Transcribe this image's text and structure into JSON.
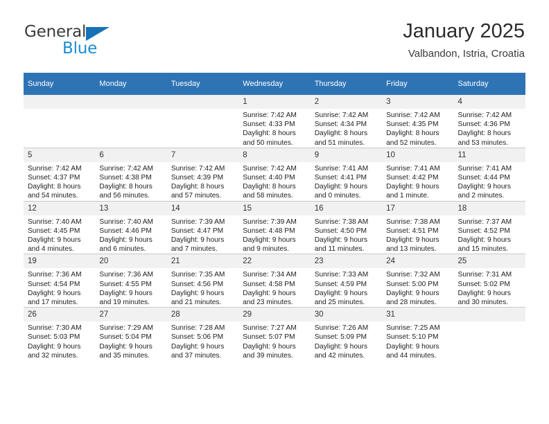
{
  "brand": {
    "word_one": "General",
    "word_two": "Blue",
    "triangle_icon": "brand-triangle-icon",
    "accent_color": "#1672b8",
    "blue_text_color": "#1b8cd4"
  },
  "header": {
    "title": "January 2025",
    "subtitle": "Valbandon, Istria, Croatia"
  },
  "theme": {
    "header_row_bg": "#2e74b5",
    "daynum_strip_bg": "#f1f1f1",
    "grid_line": "#c8c8c8"
  },
  "weekday_headers": [
    "Sunday",
    "Monday",
    "Tuesday",
    "Wednesday",
    "Thursday",
    "Friday",
    "Saturday"
  ],
  "weeks": [
    [
      {
        "day": "",
        "blank": true,
        "lines": []
      },
      {
        "day": "",
        "blank": true,
        "lines": []
      },
      {
        "day": "",
        "blank": true,
        "lines": []
      },
      {
        "day": "1",
        "blank": false,
        "lines": [
          "Sunrise: 7:42 AM",
          "Sunset: 4:33 PM",
          "Daylight: 8 hours",
          "and 50 minutes."
        ]
      },
      {
        "day": "2",
        "blank": false,
        "lines": [
          "Sunrise: 7:42 AM",
          "Sunset: 4:34 PM",
          "Daylight: 8 hours",
          "and 51 minutes."
        ]
      },
      {
        "day": "3",
        "blank": false,
        "lines": [
          "Sunrise: 7:42 AM",
          "Sunset: 4:35 PM",
          "Daylight: 8 hours",
          "and 52 minutes."
        ]
      },
      {
        "day": "4",
        "blank": false,
        "lines": [
          "Sunrise: 7:42 AM",
          "Sunset: 4:36 PM",
          "Daylight: 8 hours",
          "and 53 minutes."
        ]
      }
    ],
    [
      {
        "day": "5",
        "blank": false,
        "lines": [
          "Sunrise: 7:42 AM",
          "Sunset: 4:37 PM",
          "Daylight: 8 hours",
          "and 54 minutes."
        ]
      },
      {
        "day": "6",
        "blank": false,
        "lines": [
          "Sunrise: 7:42 AM",
          "Sunset: 4:38 PM",
          "Daylight: 8 hours",
          "and 56 minutes."
        ]
      },
      {
        "day": "7",
        "blank": false,
        "lines": [
          "Sunrise: 7:42 AM",
          "Sunset: 4:39 PM",
          "Daylight: 8 hours",
          "and 57 minutes."
        ]
      },
      {
        "day": "8",
        "blank": false,
        "lines": [
          "Sunrise: 7:42 AM",
          "Sunset: 4:40 PM",
          "Daylight: 8 hours",
          "and 58 minutes."
        ]
      },
      {
        "day": "9",
        "blank": false,
        "lines": [
          "Sunrise: 7:41 AM",
          "Sunset: 4:41 PM",
          "Daylight: 9 hours",
          "and 0 minutes."
        ]
      },
      {
        "day": "10",
        "blank": false,
        "lines": [
          "Sunrise: 7:41 AM",
          "Sunset: 4:42 PM",
          "Daylight: 9 hours",
          "and 1 minute."
        ]
      },
      {
        "day": "11",
        "blank": false,
        "lines": [
          "Sunrise: 7:41 AM",
          "Sunset: 4:44 PM",
          "Daylight: 9 hours",
          "and 2 minutes."
        ]
      }
    ],
    [
      {
        "day": "12",
        "blank": false,
        "lines": [
          "Sunrise: 7:40 AM",
          "Sunset: 4:45 PM",
          "Daylight: 9 hours",
          "and 4 minutes."
        ]
      },
      {
        "day": "13",
        "blank": false,
        "lines": [
          "Sunrise: 7:40 AM",
          "Sunset: 4:46 PM",
          "Daylight: 9 hours",
          "and 6 minutes."
        ]
      },
      {
        "day": "14",
        "blank": false,
        "lines": [
          "Sunrise: 7:39 AM",
          "Sunset: 4:47 PM",
          "Daylight: 9 hours",
          "and 7 minutes."
        ]
      },
      {
        "day": "15",
        "blank": false,
        "lines": [
          "Sunrise: 7:39 AM",
          "Sunset: 4:48 PM",
          "Daylight: 9 hours",
          "and 9 minutes."
        ]
      },
      {
        "day": "16",
        "blank": false,
        "lines": [
          "Sunrise: 7:38 AM",
          "Sunset: 4:50 PM",
          "Daylight: 9 hours",
          "and 11 minutes."
        ]
      },
      {
        "day": "17",
        "blank": false,
        "lines": [
          "Sunrise: 7:38 AM",
          "Sunset: 4:51 PM",
          "Daylight: 9 hours",
          "and 13 minutes."
        ]
      },
      {
        "day": "18",
        "blank": false,
        "lines": [
          "Sunrise: 7:37 AM",
          "Sunset: 4:52 PM",
          "Daylight: 9 hours",
          "and 15 minutes."
        ]
      }
    ],
    [
      {
        "day": "19",
        "blank": false,
        "lines": [
          "Sunrise: 7:36 AM",
          "Sunset: 4:54 PM",
          "Daylight: 9 hours",
          "and 17 minutes."
        ]
      },
      {
        "day": "20",
        "blank": false,
        "lines": [
          "Sunrise: 7:36 AM",
          "Sunset: 4:55 PM",
          "Daylight: 9 hours",
          "and 19 minutes."
        ]
      },
      {
        "day": "21",
        "blank": false,
        "lines": [
          "Sunrise: 7:35 AM",
          "Sunset: 4:56 PM",
          "Daylight: 9 hours",
          "and 21 minutes."
        ]
      },
      {
        "day": "22",
        "blank": false,
        "lines": [
          "Sunrise: 7:34 AM",
          "Sunset: 4:58 PM",
          "Daylight: 9 hours",
          "and 23 minutes."
        ]
      },
      {
        "day": "23",
        "blank": false,
        "lines": [
          "Sunrise: 7:33 AM",
          "Sunset: 4:59 PM",
          "Daylight: 9 hours",
          "and 25 minutes."
        ]
      },
      {
        "day": "24",
        "blank": false,
        "lines": [
          "Sunrise: 7:32 AM",
          "Sunset: 5:00 PM",
          "Daylight: 9 hours",
          "and 28 minutes."
        ]
      },
      {
        "day": "25",
        "blank": false,
        "lines": [
          "Sunrise: 7:31 AM",
          "Sunset: 5:02 PM",
          "Daylight: 9 hours",
          "and 30 minutes."
        ]
      }
    ],
    [
      {
        "day": "26",
        "blank": false,
        "lines": [
          "Sunrise: 7:30 AM",
          "Sunset: 5:03 PM",
          "Daylight: 9 hours",
          "and 32 minutes."
        ]
      },
      {
        "day": "27",
        "blank": false,
        "lines": [
          "Sunrise: 7:29 AM",
          "Sunset: 5:04 PM",
          "Daylight: 9 hours",
          "and 35 minutes."
        ]
      },
      {
        "day": "28",
        "blank": false,
        "lines": [
          "Sunrise: 7:28 AM",
          "Sunset: 5:06 PM",
          "Daylight: 9 hours",
          "and 37 minutes."
        ]
      },
      {
        "day": "29",
        "blank": false,
        "lines": [
          "Sunrise: 7:27 AM",
          "Sunset: 5:07 PM",
          "Daylight: 9 hours",
          "and 39 minutes."
        ]
      },
      {
        "day": "30",
        "blank": false,
        "lines": [
          "Sunrise: 7:26 AM",
          "Sunset: 5:09 PM",
          "Daylight: 9 hours",
          "and 42 minutes."
        ]
      },
      {
        "day": "31",
        "blank": false,
        "lines": [
          "Sunrise: 7:25 AM",
          "Sunset: 5:10 PM",
          "Daylight: 9 hours",
          "and 44 minutes."
        ]
      },
      {
        "day": "",
        "blank": true,
        "lines": []
      }
    ]
  ]
}
